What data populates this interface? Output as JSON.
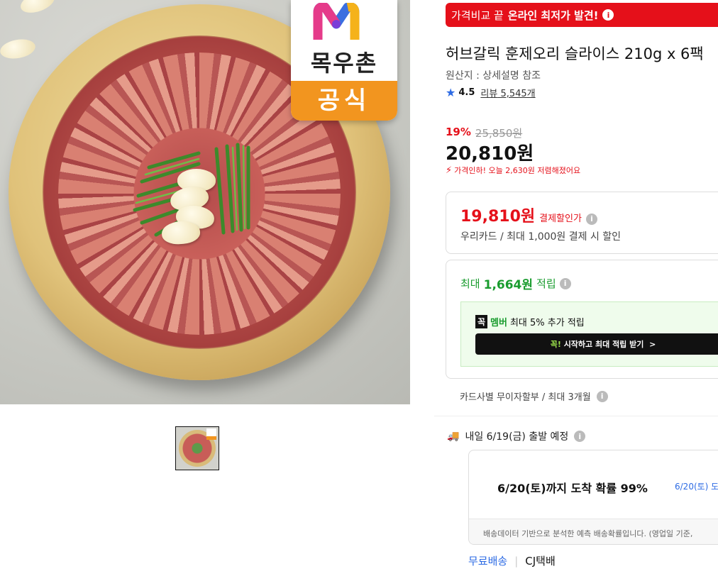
{
  "promo_banner": {
    "text_plain": "가격비교 끝",
    "text_bold": "온라인 최저가 발견!",
    "info_icon": "i"
  },
  "product": {
    "title": "허브갈릭 훈제오리 슬라이스 210g x 6팩",
    "origin": "원산지 : 상세설명 참조",
    "rating": "4.5",
    "review_label": "리뷰",
    "review_count": "5,545개"
  },
  "badge": {
    "brand": "목우촌",
    "official": "공식"
  },
  "pricing": {
    "discount_rate": "19%",
    "original_price": "25,850원",
    "sale_price": "20,810원",
    "price_drop_note": "가격인하! 오늘 2,630원 저렴해졌어요"
  },
  "card_discount": {
    "amount": "19,810원",
    "label": "결제할인가",
    "note": "우리카드 / 최대 1,000원 결제 시 할인"
  },
  "rewards": {
    "prefix": "최대",
    "amount": "1,664원",
    "suffix": "적립",
    "member_tag1": "꼭",
    "member_tag2": "멤버",
    "member_text": "최대 5% 추가 적립",
    "member_button": "시작하고 최대 적립 받기",
    "member_button_prefix": "꼭!",
    "member_button_arrow": ">"
  },
  "installment": "카드사별 무이자할부 / 최대 3개월",
  "shipping": {
    "departure": "내일 6/19(금) 출발 예정",
    "arrival": "6/20(토)까지 도착 확률 99%",
    "arrival_side": "6/20(토) 도",
    "footnote": "배송데이터 기반으로 분석한 예측 배송확률입니다. (영업일 기준,",
    "free_shipping": "무료배송",
    "separator": "|",
    "carrier": "CJ택배"
  },
  "icons": {
    "star": "★",
    "bolt": "⚡",
    "truck": "🚚",
    "info": "i"
  },
  "colors": {
    "accent_red": "#e5101a",
    "accent_green": "#1a9c2f",
    "accent_blue": "#2d6be4",
    "badge_orange": "#f2951f"
  }
}
